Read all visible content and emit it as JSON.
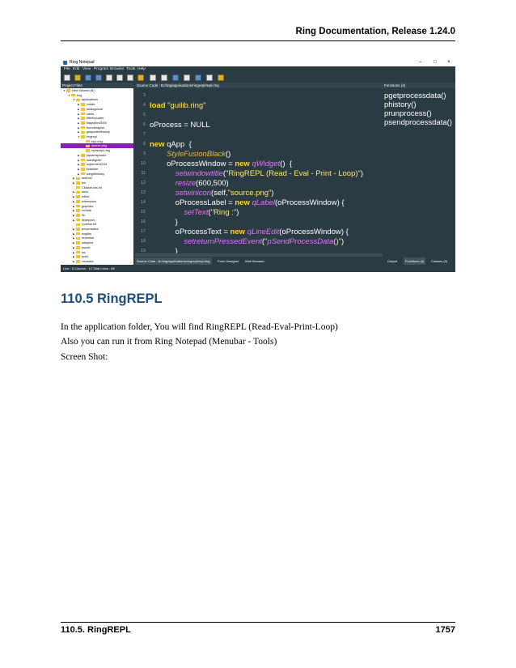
{
  "header": {
    "title": "Ring Documentation, Release 1.24.0"
  },
  "screenshot": {
    "window_title": "Ring Notepad",
    "window_controls": [
      "–",
      "□",
      "×"
    ],
    "menu": [
      "File",
      "Edit",
      "View",
      "Program",
      "Browser",
      "Tools",
      "Help"
    ],
    "panels": {
      "project_files": "Project Files",
      "source_code": "Source Code : B:/ring/applications/ringrepl/repl.ring",
      "functions": "Functions (4)"
    },
    "tree": [
      {
        "label": "New Volume (B:)",
        "depth": 0,
        "arrow": "▼"
      },
      {
        "label": "ring",
        "depth": 1,
        "arrow": "▼"
      },
      {
        "label": "applications",
        "depth": 2,
        "arrow": "▼"
      },
      {
        "label": "cmate",
        "depth": 3,
        "arrow": "▶"
      },
      {
        "label": "analogclock",
        "depth": 3,
        "arrow": "▶"
      },
      {
        "label": "cards",
        "depth": 3,
        "arrow": "▶"
      },
      {
        "label": "fifteenpuzzle",
        "depth": 3,
        "arrow": "▶"
      },
      {
        "label": "flappybird3000",
        "depth": 3,
        "arrow": "▶"
      },
      {
        "label": "formdesigner",
        "depth": 3,
        "arrow": "▶"
      },
      {
        "label": "getquotesfhistory",
        "depth": 3,
        "arrow": "▶"
      },
      {
        "label": "ringrepl",
        "depth": 3,
        "arrow": "▼"
      },
      {
        "label": "repl.ring",
        "depth": 4,
        "arrow": ""
      },
      {
        "label": "source.png",
        "depth": 4,
        "arrow": "",
        "selected": true
      },
      {
        "label": "replscript.ring",
        "depth": 4,
        "arrow": ""
      },
      {
        "label": "squarespuzzle",
        "depth": 3,
        "arrow": "▶"
      },
      {
        "label": "starsfighter",
        "depth": 3,
        "arrow": "▶"
      },
      {
        "label": "supermen2016",
        "depth": 3,
        "arrow": "▶"
      },
      {
        "label": "tictactoe",
        "depth": 3,
        "arrow": "▶"
      },
      {
        "label": "weighthistory",
        "depth": 3,
        "arrow": "▶"
      },
      {
        "label": "android",
        "depth": 2,
        "arrow": "▶"
      },
      {
        "label": "bin",
        "depth": 2,
        "arrow": "▶"
      },
      {
        "label": "CMakeLists.txt",
        "depth": 2,
        "arrow": ""
      },
      {
        "label": "docs",
        "depth": 2,
        "arrow": "▶"
      },
      {
        "label": "editor",
        "depth": 2,
        "arrow": "▶"
      },
      {
        "label": "extensions",
        "depth": 2,
        "arrow": "▶"
      },
      {
        "label": "graphics",
        "depth": 2,
        "arrow": "▶"
      },
      {
        "label": "include",
        "depth": 2,
        "arrow": "▶"
      },
      {
        "label": "lib",
        "depth": 2,
        "arrow": "▶"
      },
      {
        "label": "libdepwin",
        "depth": 2,
        "arrow": "▶"
      },
      {
        "label": "License.txt",
        "depth": 2,
        "arrow": ""
      },
      {
        "label": "presentation",
        "depth": 2,
        "arrow": "▶"
      },
      {
        "label": "ringlibs",
        "depth": 2,
        "arrow": "▶"
      },
      {
        "label": "reviewse",
        "depth": 2,
        "arrow": "▶"
      },
      {
        "label": "samples",
        "depth": 2,
        "arrow": "▶"
      },
      {
        "label": "sound",
        "depth": 2,
        "arrow": "▶"
      },
      {
        "label": "src",
        "depth": 2,
        "arrow": "▶"
      },
      {
        "label": "tools",
        "depth": 2,
        "arrow": "▶"
      },
      {
        "label": "visualsrc",
        "depth": 2,
        "arrow": "▶"
      }
    ],
    "code_lines": [
      {
        "num": "3",
        "html": ""
      },
      {
        "num": "4",
        "html": "<span class='kw'>load</span> <span class='str'>\"guilib.ring\"</span>"
      },
      {
        "num": "5",
        "html": ""
      },
      {
        "num": "6",
        "html": "oProcess = NULL"
      },
      {
        "num": "7",
        "html": ""
      },
      {
        "num": "8",
        "html": "<span class='kw'>new</span> qApp  {"
      },
      {
        "num": "9",
        "html": "        <span class='it'>StyleFusionBlack</span>()"
      },
      {
        "num": "10",
        "html": "        oProcessWindow = <span class='kw'>new</span> <span class='pu'>qWidget</span>()  {"
      },
      {
        "num": "11",
        "html": "            <span class='pu'>setwindowtitle</span>(<span class='str'>\"RingREPL (Read - Eval - Print - Loop)\"</span>)"
      },
      {
        "num": "12",
        "html": "            <span class='pu'>resize</span>(600,500)"
      },
      {
        "num": "13",
        "html": "            <span class='pu'>setwinicon</span>(self,<span class='str'>\"source.png\"</span>)"
      },
      {
        "num": "14",
        "html": "            oProcessLabel = <span class='kw'>new</span> <span class='pu'>qLabel</span>(oProcessWindow) {"
      },
      {
        "num": "15",
        "html": "                <span class='pu'>setText</span>(<span class='str'>\"Ring :\"</span>)"
      },
      {
        "num": "16",
        "html": "            }"
      },
      {
        "num": "17",
        "html": "            oProcessText = <span class='kw'>new</span> <span class='pu'>qLineEdit</span>(oProcessWindow) {"
      },
      {
        "num": "18",
        "html": "                <span class='pu'>setreturnPressedEvent</span>(<span class='str'>\"</span><span class='pu'>pSendProcessData</span><span class='str'>()\"</span>)"
      },
      {
        "num": "19",
        "html": "            }"
      }
    ],
    "functions": [
      "pgetprocessdata()",
      "phistory()",
      "prunprocess()",
      "psendprocessdata()"
    ],
    "bottom_tabs": [
      "Source Code : B:/ring/applications/ringrepl/repl.ring",
      "Form Designer",
      "Web Browser",
      "Output",
      "Functions (4)",
      "Classes (0)"
    ],
    "status": "Line : 8 Column : 12 Total Lines : 88"
  },
  "section": {
    "number": "110.5",
    "title": "RingREPL",
    "full": "110.5 RingREPL"
  },
  "paragraphs": [
    "In the application folder, You will find RingREPL (Read-Eval-Print-Loop)",
    "Also you can run it from Ring Notepad (Menubar - Tools)",
    "Screen Shot:"
  ],
  "footer": {
    "left": "110.5.  RingREPL",
    "right": "1757"
  }
}
